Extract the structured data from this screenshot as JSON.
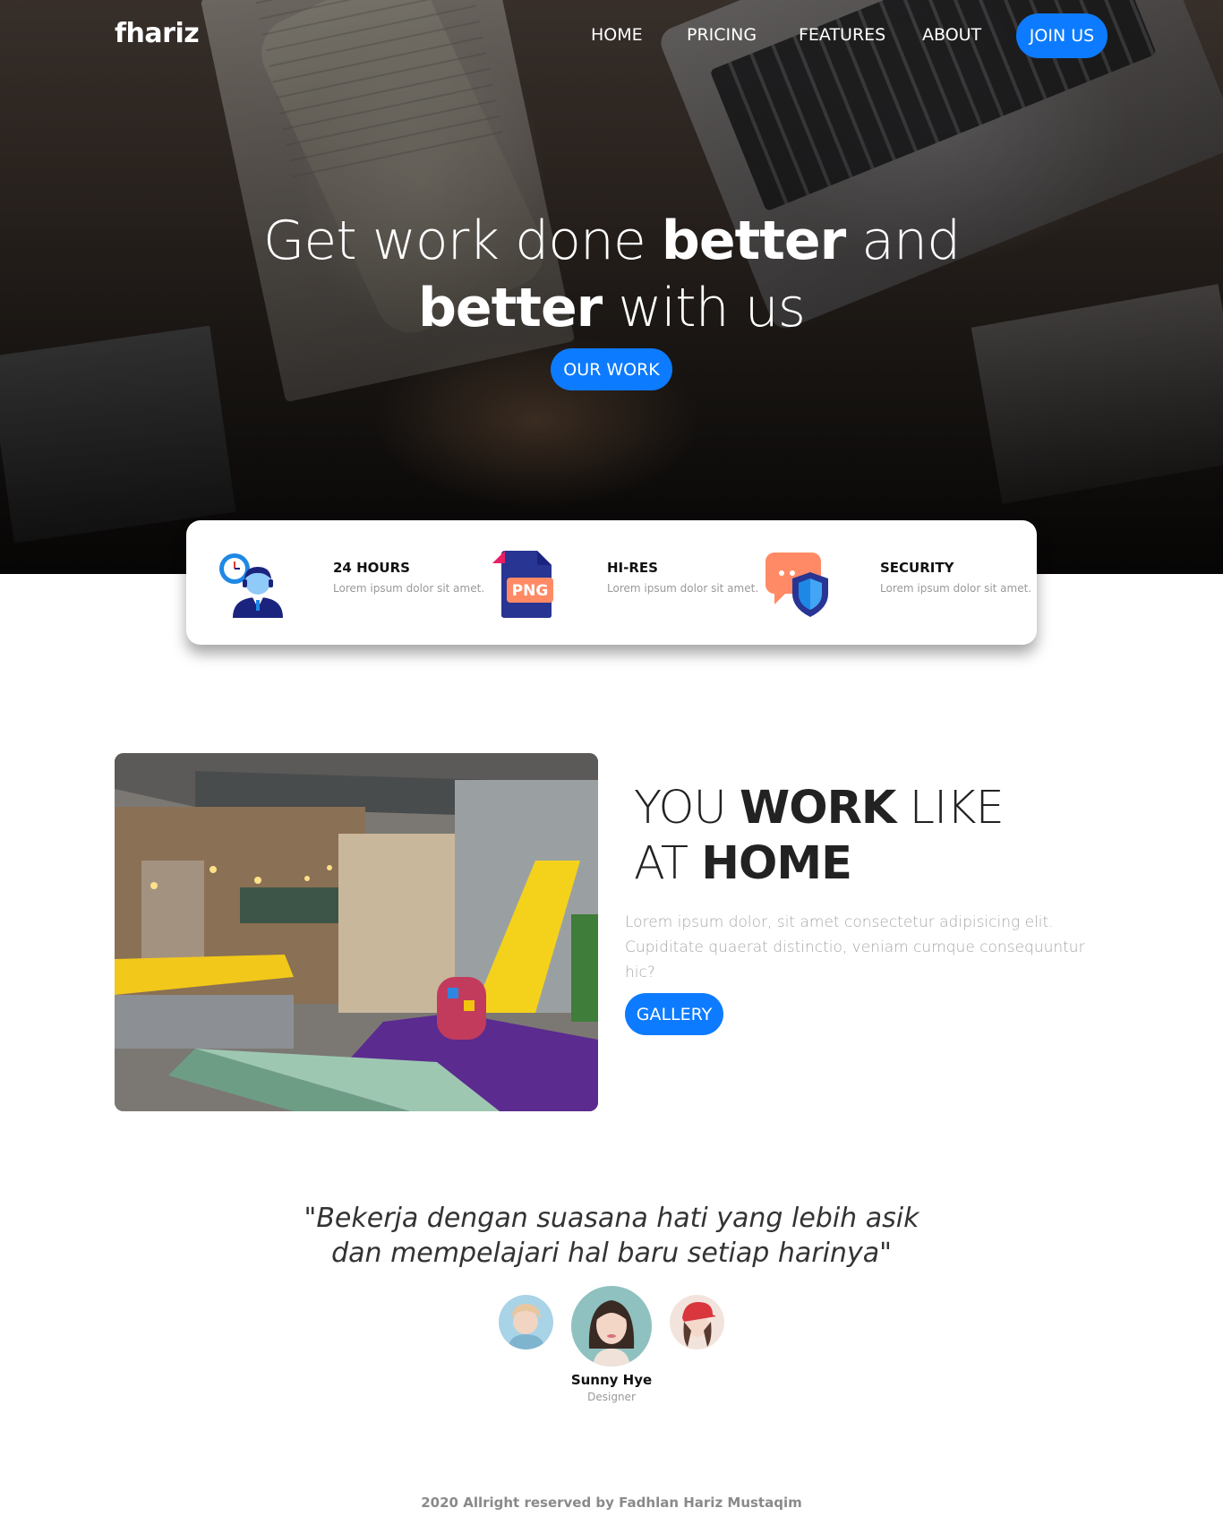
{
  "brand": "fhariz",
  "nav": {
    "items": [
      "HOME",
      "PRICING",
      "FEATURES",
      "ABOUT"
    ],
    "join_label": "JOIN US"
  },
  "hero": {
    "line1_light": "Get work done ",
    "line1_bold": "better",
    "line1_end": " and",
    "line2_bold": "better",
    "line2_end": " with us",
    "button_label": "OUR WORK"
  },
  "features": [
    {
      "title": "24 HOURS",
      "desc": "Lorem ipsum dolor sit amet.",
      "icon": "support-agent-clock-icon"
    },
    {
      "title": "HI-RES",
      "desc": "Lorem ipsum dolor sit amet.",
      "icon": "png-file-icon",
      "badge": "PNG"
    },
    {
      "title": "SECURITY",
      "desc": "Lorem ipsum dolor sit amet.",
      "icon": "chat-shield-icon"
    }
  ],
  "work": {
    "heading_line1_light": "YOU ",
    "heading_line1_bold": "WORK",
    "heading_line1_end": " LIKE",
    "heading_line2_light": "AT ",
    "heading_line2_bold": "HOME",
    "text": "Lorem ipsum dolor, sit amet consectetur adipisicing elit. Cupiditate quaerat distinctio, veniam cumque consequuntur hic?",
    "button_label": "GALLERY"
  },
  "testimonial": {
    "quote_line1": "\"Bekerja dengan suasana hati yang lebih asik",
    "quote_line2": "dan mempelajari hal baru setiap harinya\"",
    "name": "Sunny Hye",
    "role": "Designer"
  },
  "footer": "2020 Allright reserved by Fadhlan Hariz Mustaqim",
  "colors": {
    "accent": "#0d7bff",
    "text_dark": "#212529",
    "muted": "#999999"
  }
}
